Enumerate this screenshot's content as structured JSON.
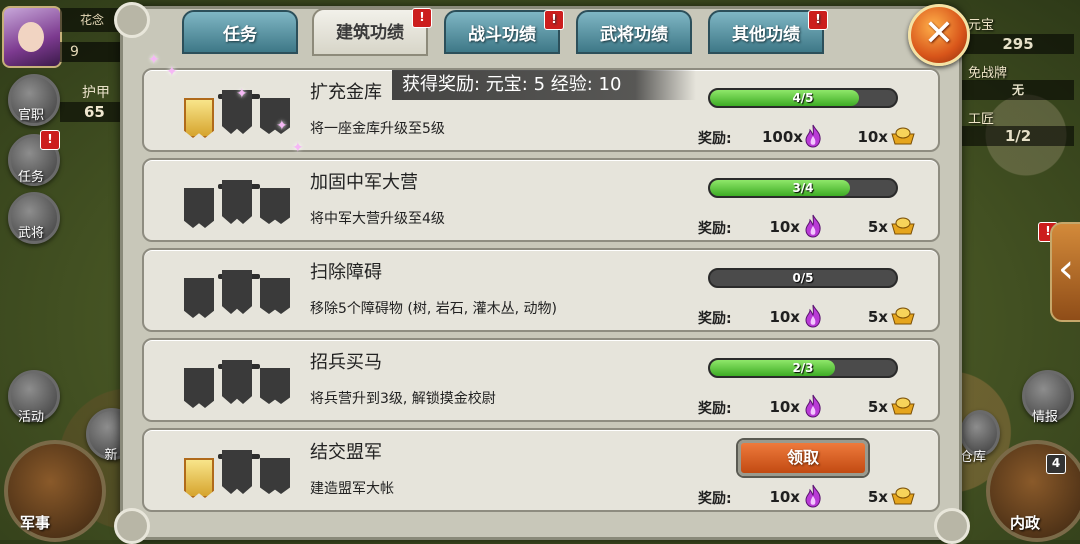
{
  "player": {
    "name": "花念",
    "level": "9",
    "stat_label": "护甲",
    "stat_value": "65"
  },
  "left_menu": [
    {
      "label": "官职"
    },
    {
      "label": "任务",
      "badge": "!"
    },
    {
      "label": "武将"
    },
    {
      "label": "活动"
    },
    {
      "label": "新"
    }
  ],
  "left_bottom": {
    "label": "军事"
  },
  "right_hud": {
    "currency_label": "元宝",
    "currency_value": "295",
    "token_label": "免战牌",
    "token_value": "无",
    "worker_label": "工匠",
    "worker_value": "1/2",
    "intel_label": "情报",
    "warehouse_label": "仓库",
    "internal_label": "内政",
    "internal_badge": "4",
    "side_badge": "!"
  },
  "tabs": [
    {
      "label": "任务",
      "active": false,
      "badge": ""
    },
    {
      "label": "建筑功绩",
      "active": true,
      "badge": "!"
    },
    {
      "label": "战斗功绩",
      "active": false,
      "badge": "!"
    },
    {
      "label": "武将功绩",
      "active": false,
      "badge": ""
    },
    {
      "label": "其他功绩",
      "active": false,
      "badge": "!"
    }
  ],
  "close_label": "✕",
  "tooltip": "获得奖励: 元宝: 5 经验: 10",
  "reward_label": "奖励:",
  "achievements": [
    {
      "title": "扩充金库",
      "desc": "将一座金库升级至5级",
      "progress_text": "4/5",
      "progress": 0.8,
      "reward1": "100x",
      "reward2": "10x",
      "gold_flag": true
    },
    {
      "title": "加固中军大营",
      "desc": "将中军大营升级至4级",
      "progress_text": "3/4",
      "progress": 0.75,
      "reward1": "10x",
      "reward2": "5x",
      "gold_flag": false
    },
    {
      "title": "扫除障碍",
      "desc": "移除5个障碍物 (树, 岩石, 灌木丛, 动物)",
      "progress_text": "0/5",
      "progress": 0.0,
      "reward1": "10x",
      "reward2": "5x",
      "gold_flag": false
    },
    {
      "title": "招兵买马",
      "desc": "将兵营升到3级, 解锁摸金校尉",
      "progress_text": "2/3",
      "progress": 0.67,
      "reward1": "10x",
      "reward2": "5x",
      "gold_flag": false
    },
    {
      "title": "结交盟军",
      "desc": "建造盟军大帐",
      "claim_label": "领取",
      "reward1": "10x",
      "reward2": "5x",
      "gold_flag": true
    }
  ],
  "colors": {
    "tab_blue": "#3e7887",
    "progress_green": "#3eac25",
    "claim_orange": "#c24a12"
  }
}
